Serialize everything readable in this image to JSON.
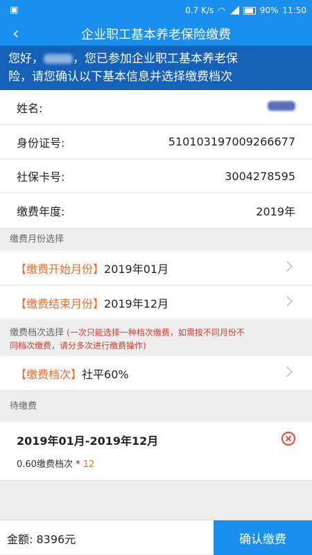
{
  "status": {
    "net_speed": "0.7 K/s",
    "battery": "90%",
    "time": "11:50"
  },
  "header": {
    "back_glyph": "‹",
    "title": "企业职工基本养老保险缴费"
  },
  "notice": {
    "line1_prefix": "您好，",
    "line1_suffix": "，您已参加企业职工基本养老保",
    "line2": "险，请您确认以下基本信息并选择缴费档次"
  },
  "info": {
    "name_label": "姓名:",
    "id_label": "身份证号:",
    "id_value": "510103197009266677",
    "card_label": "社保卡号:",
    "card_value": "3004278595",
    "year_label": "缴费年度:",
    "year_value": "2019年"
  },
  "month_section": {
    "title": "缴费月份选择",
    "start_tag": "【缴费开始月份】",
    "start_value": "2019年01月",
    "end_tag": "【缴费结束月份】",
    "end_value": "2019年12月"
  },
  "grade_section": {
    "title": "缴费档次选择",
    "warning_line1": "(一次只能选择一种档次缴费，如需按不同月份不",
    "warning_line2": "同档次缴费，请分多次进行缴费操作)",
    "grade_tag": "【缴费档次】",
    "grade_value": "社平60%"
  },
  "pending": {
    "title": "待缴费",
    "period": "2019年01月-2019年12月",
    "detail_prefix": "0.60缴费档次 * ",
    "detail_count": "12"
  },
  "footer": {
    "amount": "金额: 8396元",
    "confirm_label": "确认缴费"
  },
  "colors": {
    "primary": "#1a8fef",
    "notice_bg": "#1560b8",
    "accent": "#f06a2a",
    "warning": "#d63b2c"
  }
}
